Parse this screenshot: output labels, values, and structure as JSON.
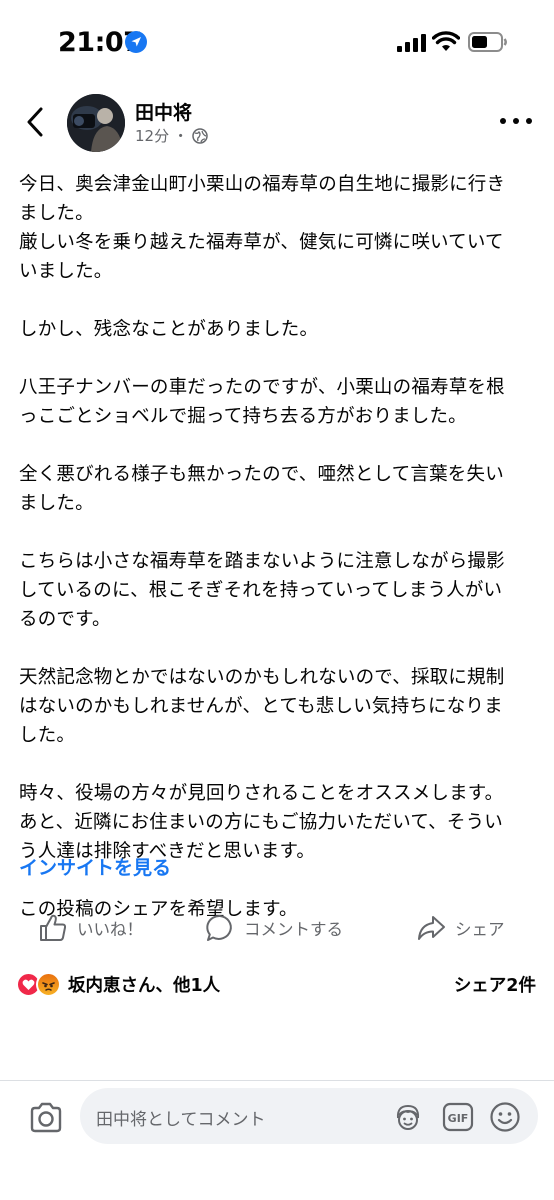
{
  "status_bar": {
    "time": "21:07"
  },
  "header": {
    "author": "田中将",
    "time_ago": "12分",
    "separator": "・"
  },
  "post": {
    "paragraphs": [
      "今日、奥会津金山町小栗山の福寿草の自生地に撮影に行き\nました。\n厳しい冬を乗り越えた福寿草が、健気に可憐に咲いていて\nいました。",
      "しかし、残念なことがありました。",
      "八王子ナンバーの車だったのですが、小栗山の福寿草を根\nっこごとショベルで掘って持ち去る方がおりました。",
      "全く悪びれる様子も無かったので、唖然として言葉を失い\nました。",
      "こちらは小さな福寿草を踏まないように注意しながら撮影\nしているのに、根こそぎそれを持っていってしまう人がい\nるのです。",
      "天然記念物とかではないのかもしれないので、採取に規制\nはないのかもしれませんが、とても悲しい気持ちになりま\nした。",
      "時々、役場の方々が見回りされることをオススメします。\nあと、近隣にお住まいの方にもご協力いただいて、そうい\nう人達は排除すべきだと思います。",
      "この投稿のシェアを希望します。"
    ],
    "insights_link": "インサイトを見る"
  },
  "actions": {
    "like": "いいね！",
    "comment": "コメントする",
    "share": "シェア"
  },
  "reactions": {
    "summary": "坂内恵さん、他1人",
    "share_count": "シェア2件"
  },
  "comment_bar": {
    "placeholder": "田中将としてコメント",
    "gif_label": "GIF"
  },
  "colors": {
    "link": "#1877f2",
    "secondary_text": "#65676b",
    "love": "#f02849",
    "comment_bg": "#f0f2f5"
  }
}
